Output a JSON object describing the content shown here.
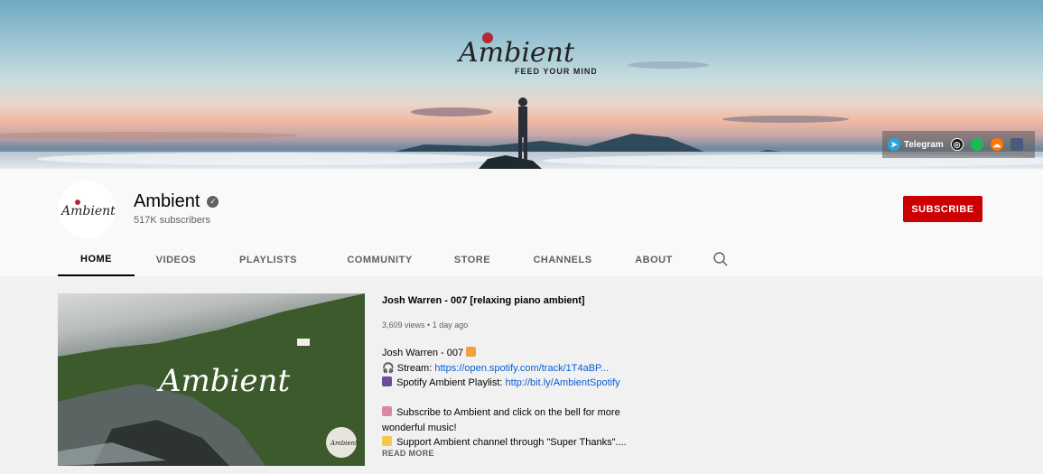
{
  "banner": {
    "logo_text": "Ambient",
    "logo_tagline": "FEED YOUR MIND.",
    "links": [
      {
        "label": "Telegram",
        "icon": "telegram-icon",
        "color": "#2aa3df"
      },
      {
        "label": "",
        "icon": "spotify-alt-icon",
        "color": "#111111"
      },
      {
        "label": "",
        "icon": "spotify-icon",
        "color": "#1db954"
      },
      {
        "label": "",
        "icon": "soundcloud-icon",
        "color": "#ff7700"
      },
      {
        "label": "",
        "icon": "image-link-icon",
        "color": "#4a5a7a"
      }
    ]
  },
  "channel": {
    "name": "Ambient",
    "avatar_text": "Ambient",
    "subscribers": "517K subscribers",
    "subscribe_label": "SUBSCRIBE",
    "subscribe_color": "#cc0000"
  },
  "tabs": [
    {
      "label": "HOME",
      "active": true
    },
    {
      "label": "VIDEOS",
      "active": false
    },
    {
      "label": "PLAYLISTS",
      "active": false
    },
    {
      "label": "COMMUNITY",
      "active": false
    },
    {
      "label": "STORE",
      "active": false
    },
    {
      "label": "CHANNELS",
      "active": false
    },
    {
      "label": "ABOUT",
      "active": false
    }
  ],
  "featured": {
    "thumbnail_text": "Ambient",
    "watermark_text": "Ambient",
    "title": "Josh Warren - 007 [relaxing piano ambient]",
    "views": "3,609 views",
    "age": "1 day ago",
    "desc_line1": "Josh Warren - 007",
    "stream_label": "Stream: ",
    "stream_link": "https://open.spotify.com/track/1T4aBP...",
    "playlist_label": "Spotify Ambient Playlist: ",
    "playlist_link": "http://bit.ly/AmbientSpotify",
    "subscribe_text": "Subscribe to Ambient and click on the bell for more wonderful music!",
    "support_text": "Support Ambient channel through \"Super Thanks\"....",
    "read_more": "READ MORE"
  }
}
